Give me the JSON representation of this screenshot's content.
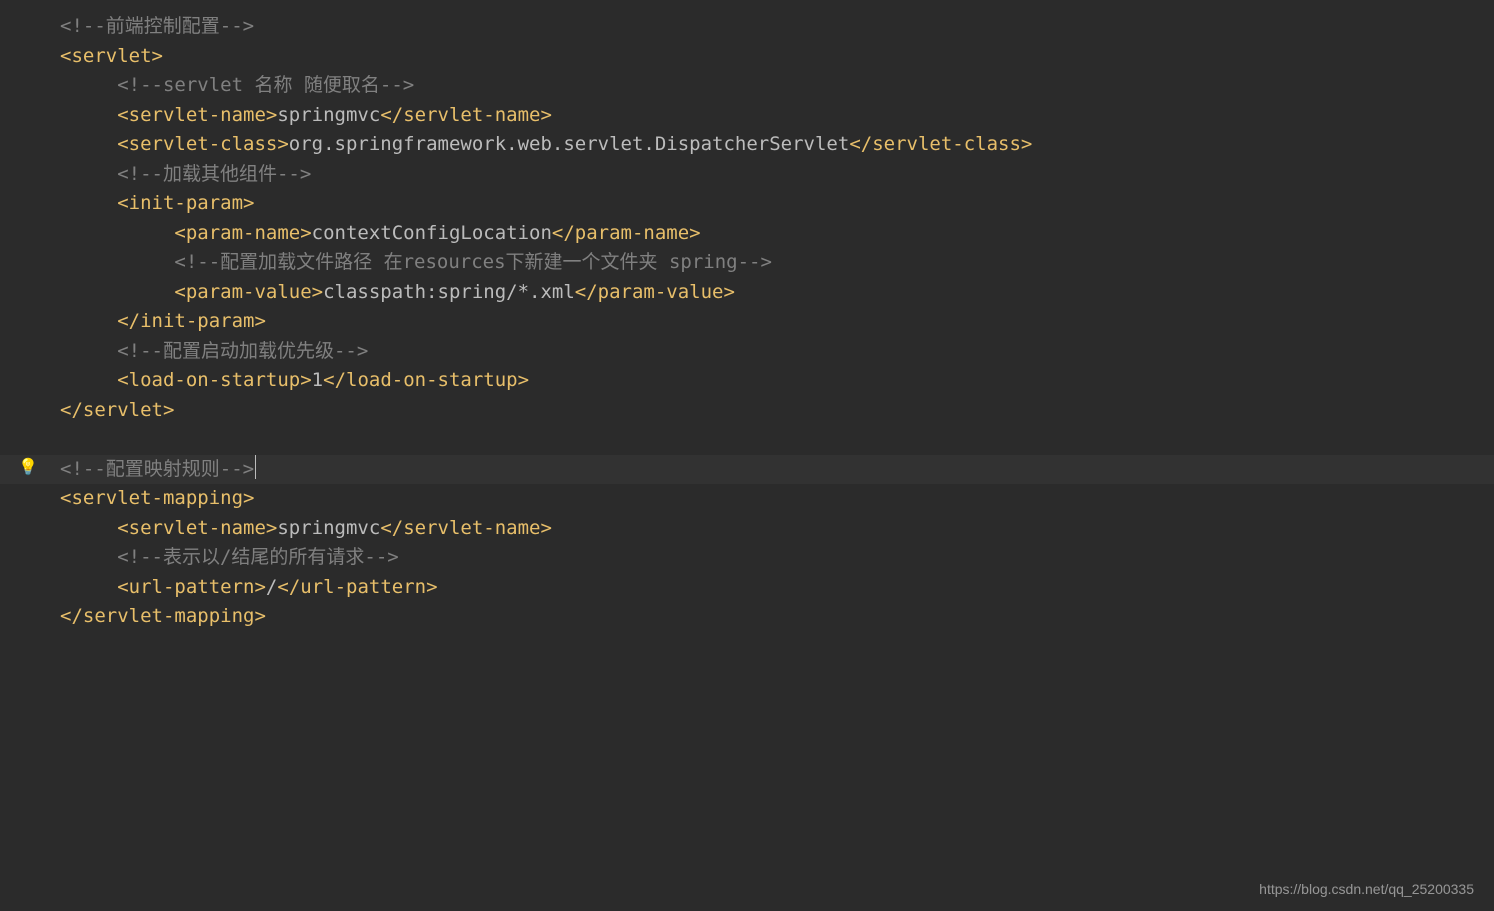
{
  "code": {
    "l1": "<!--前端控制配置-->",
    "l2_open": "<servlet>",
    "l3": "<!--servlet 名称 随便取名-->",
    "l4_open": "<servlet-name>",
    "l4_text": "springmvc",
    "l4_close": "</servlet-name>",
    "l5_open": "<servlet-class>",
    "l5_text": "org.springframework.web.servlet.DispatcherServlet",
    "l5_close": "</servlet-class>",
    "l6": "<!--加载其他组件-->",
    "l7_open": "<init-param>",
    "l8_open": "<param-name>",
    "l8_text": "contextConfigLocation",
    "l8_close": "</param-name>",
    "l9": "<!--配置加载文件路径 在resources下新建一个文件夹 spring-->",
    "l10_open": "<param-value>",
    "l10_text": "classpath:spring/*.xml",
    "l10_close": "</param-value>",
    "l11_close": "</init-param>",
    "l12": "<!--配置启动加载优先级-->",
    "l13_open": "<load-on-startup>",
    "l13_text": "1",
    "l13_close": "</load-on-startup>",
    "l14_close": "</servlet>",
    "l16": "<!--配置映射规则-->",
    "l17_open": "<servlet-mapping>",
    "l18_open": "<servlet-name>",
    "l18_text": "springmvc",
    "l18_close": "</servlet-name>",
    "l19": "<!--表示以/结尾的所有请求-->",
    "l20_open": "<url-pattern>",
    "l20_text": "/",
    "l20_close": "</url-pattern>",
    "l21_close": "</servlet-mapping>"
  },
  "bulb": "💡",
  "watermark": "https://blog.csdn.net/qq_25200335"
}
